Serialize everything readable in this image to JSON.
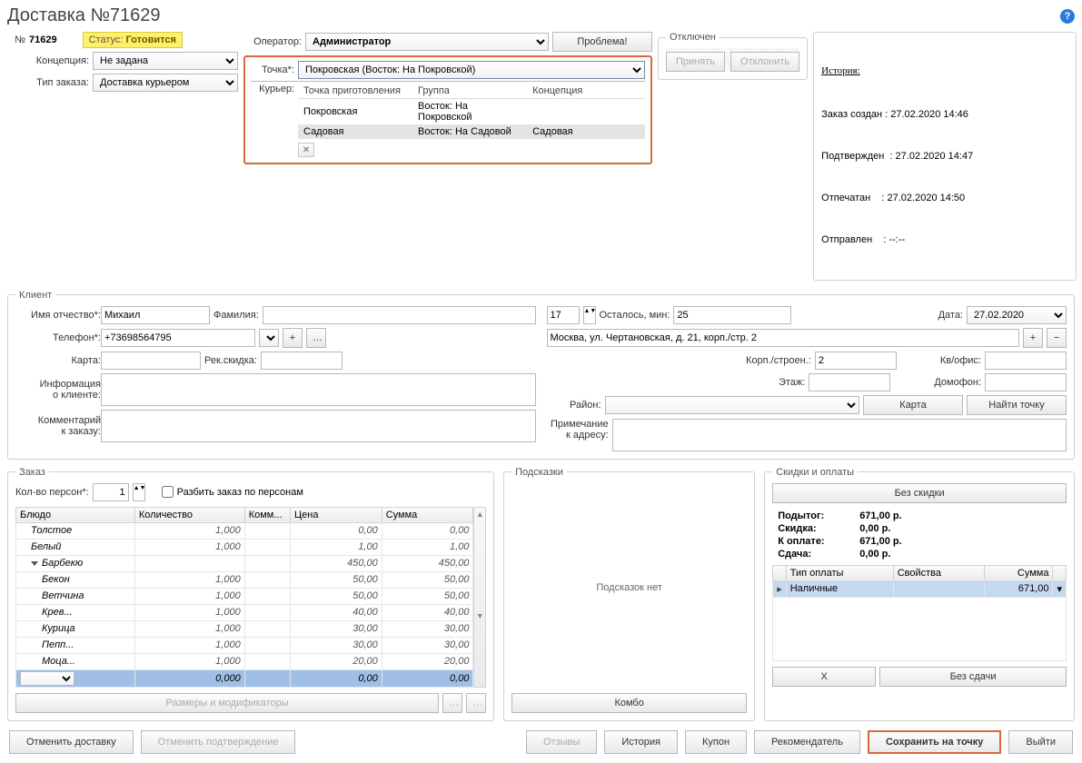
{
  "title": "Доставка №71629",
  "order_number_label": "№",
  "order_number": "71629",
  "status_label": "Статус:",
  "status_value": "Готовится",
  "operator_label": "Оператор:",
  "operator_value": "Администратор",
  "problem_button": "Проблема!",
  "concept_label": "Концепция:",
  "concept_value": "Не задана",
  "order_type_label": "Тип заказа:",
  "order_type_value": "Доставка курьером",
  "point_label": "Точка*:",
  "point_value": "Покровская (Восток: На Покровской)",
  "courier_label": "Курьер:",
  "popup": {
    "cols": [
      "Точка приготовления",
      "Группа",
      "Концепция"
    ],
    "rows": [
      {
        "point": "Покровская",
        "group": "Восток: На Покровской",
        "concept": ""
      },
      {
        "point": "Садовая",
        "group": "Восток: На Садовой",
        "concept": "Садовая"
      }
    ]
  },
  "disabled_box_title": "Отключен",
  "accept_button": "Принять",
  "reject_button": "Отклонить",
  "history_title": "История:",
  "history_lines": {
    "l1": "Заказ создан : 27.02.2020 14:46",
    "l2": "Подтвержден  : 27.02.2020 14:47",
    "l3": "Отпечатан    : 27.02.2020 14:50",
    "l4": "Отправлен    : --:--"
  },
  "client": {
    "legend": "Клиент",
    "name_label": "Имя отчество*:",
    "name_value": "Михаил",
    "surname_label": "Фамилия:",
    "duration_value": "17",
    "remaining_label": "Осталось, мин:",
    "remaining_value": "25",
    "date_label": "Дата:",
    "date_value": "27.02.2020",
    "phone_label": "Телефон*:",
    "phone_value": "+73698564795",
    "address_value": "Москва, ул. Чертановская, д. 21, корп./стр. 2",
    "card_label": "Карта:",
    "rec_discount_label": "Рек.скидка:",
    "korp_label": "Корп./строен.:",
    "korp_value": "2",
    "flat_label": "Кв/офис:",
    "info_label_1": "Информация",
    "info_label_2": "о клиенте:",
    "floor_label": "Этаж:",
    "intercom_label": "Домофон:",
    "district_label": "Район:",
    "map_button": "Карта",
    "find_point_button": "Найти точку",
    "comment_label_1": "Комментарий",
    "comment_label_2": "к заказу:",
    "addr_note_label_1": "Примечание",
    "addr_note_label_2": "к адресу:"
  },
  "order": {
    "legend": "Заказ",
    "persons_label": "Кол-во персон*:",
    "persons_value": "1",
    "split_label": "Разбить заказ по персонам",
    "cols": {
      "dish": "Блюдо",
      "qty": "Количество",
      "comm": "Комм...",
      "price": "Цена",
      "sum": "Сумма"
    },
    "rows": [
      {
        "name": "Толстое",
        "ind": 1,
        "qty": "1,000",
        "price": "0,00",
        "sum": "0,00"
      },
      {
        "name": "Белый",
        "ind": 1,
        "qty": "1,000",
        "price": "1,00",
        "sum": "1,00"
      },
      {
        "name": "Барбекю",
        "ind": 1,
        "tri": true,
        "qty": "",
        "price": "450,00",
        "sum": "450,00"
      },
      {
        "name": "Бекон",
        "ind": 2,
        "qty": "1,000",
        "price": "50,00",
        "sum": "50,00"
      },
      {
        "name": "Ветчина",
        "ind": 2,
        "qty": "1,000",
        "price": "50,00",
        "sum": "50,00"
      },
      {
        "name": "Крев...",
        "ind": 2,
        "qty": "1,000",
        "price": "40,00",
        "sum": "40,00"
      },
      {
        "name": "Курица",
        "ind": 2,
        "qty": "1,000",
        "price": "30,00",
        "sum": "30,00"
      },
      {
        "name": "Пепп...",
        "ind": 2,
        "qty": "1,000",
        "price": "30,00",
        "sum": "30,00"
      },
      {
        "name": "Моца...",
        "ind": 2,
        "qty": "1,000",
        "price": "20,00",
        "sum": "20,00"
      }
    ],
    "sel_row": {
      "qty": "0,000",
      "price": "0,00",
      "sum": "0,00"
    },
    "sizes_mods_button": "Размеры и модификаторы",
    "combo_button": "Комбо"
  },
  "hints": {
    "legend": "Подсказки",
    "empty": "Подсказок нет"
  },
  "discounts": {
    "legend": "Скидки и оплаты",
    "no_discount_button": "Без скидки",
    "subtotal_label": "Подытог:",
    "subtotal_value": "671,00 р.",
    "discount_label": "Скидка:",
    "discount_value": "0,00 р.",
    "to_pay_label": "К оплате:",
    "to_pay_value": "671,00 р.",
    "change_label": "Сдача:",
    "change_value": "0,00 р.",
    "pay_cols": {
      "type": "Тип оплаты",
      "props": "Свойства",
      "sum": "Сумма"
    },
    "pay_row": {
      "type": "Наличные",
      "props": "",
      "sum": "671,00"
    },
    "x_button": "X",
    "no_change_button": "Без сдачи"
  },
  "footer": {
    "cancel_delivery": "Отменить доставку",
    "cancel_confirm": "Отменить подтверждение",
    "reviews": "Отзывы",
    "history": "История",
    "coupon": "Купон",
    "recommender": "Рекомендатель",
    "save_to_point": "Сохранить на точку",
    "exit": "Выйти"
  }
}
